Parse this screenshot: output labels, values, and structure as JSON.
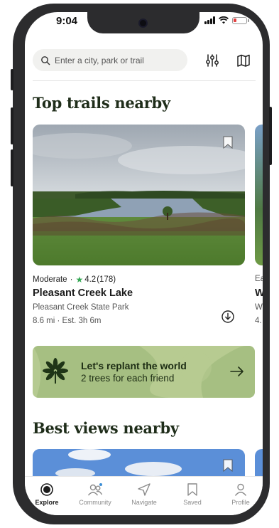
{
  "status_bar": {
    "time": "9:04"
  },
  "search": {
    "placeholder": "Enter a city, park or trail"
  },
  "header_icons": {
    "filter": "sliders-icon",
    "map": "map-icon"
  },
  "sections": {
    "top_trails": "Top trails nearby",
    "best_views": "Best views nearby"
  },
  "trail_card": {
    "difficulty": "Moderate",
    "separator": "·",
    "rating": "4.2",
    "reviews": "(178)",
    "name": "Pleasant Creek Lake",
    "park": "Pleasant Creek State Park",
    "stats": "8.6 mi · Est. 3h 6m"
  },
  "peek_card": {
    "line1": "Ea",
    "line2": "W",
    "line3": "W",
    "line4": "4."
  },
  "banner": {
    "title": "Let's replant the world",
    "subtitle": "2 trees for each friend"
  },
  "tabs": [
    {
      "label": "Explore",
      "icon": "explore-icon",
      "active": true
    },
    {
      "label": "Community",
      "icon": "community-icon",
      "active": false
    },
    {
      "label": "Navigate",
      "icon": "navigate-icon",
      "active": false
    },
    {
      "label": "Saved",
      "icon": "bookmark-icon",
      "active": false
    },
    {
      "label": "Profile",
      "icon": "profile-icon",
      "active": false
    }
  ],
  "colors": {
    "title_green": "#1f2d1a",
    "banner_bg": "#a6bf82",
    "star_green": "#34a853",
    "notification_dot": "#3d8fd6",
    "battery_low": "#e34040"
  }
}
